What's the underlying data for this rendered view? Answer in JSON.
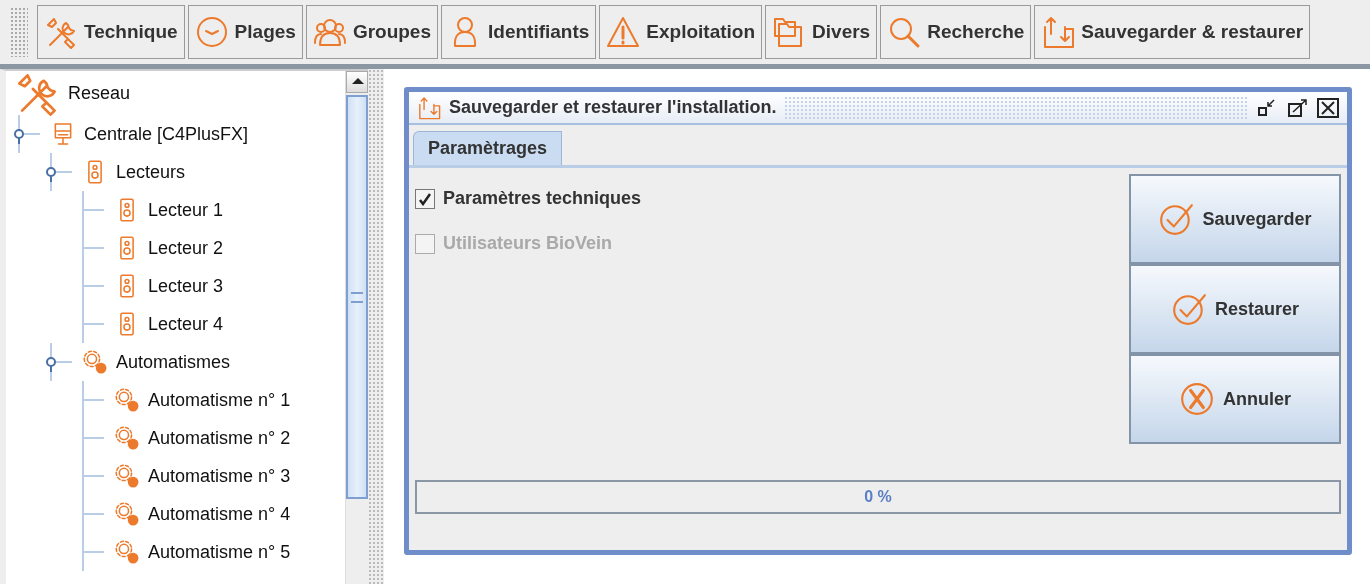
{
  "toolbar": [
    {
      "label": "Technique",
      "kind": "tools"
    },
    {
      "label": "Plages",
      "kind": "clock"
    },
    {
      "label": "Groupes",
      "kind": "group"
    },
    {
      "label": "Identifiants",
      "kind": "person"
    },
    {
      "label": "Exploitation",
      "kind": "warning"
    },
    {
      "label": "Divers",
      "kind": "folders"
    },
    {
      "label": "Recherche",
      "kind": "search"
    },
    {
      "label": "Sauvegarder & restaurer",
      "kind": "transfer"
    }
  ],
  "tree": [
    {
      "label": "Reseau",
      "kind": "tools",
      "children": [
        {
          "label": "Centrale [C4PlusFX]",
          "kind": "server",
          "expanded": true,
          "children": [
            {
              "label": "Lecteurs",
              "kind": "reader",
              "expanded": true,
              "children": [
                {
                  "label": "Lecteur 1",
                  "kind": "reader"
                },
                {
                  "label": "Lecteur 2",
                  "kind": "reader"
                },
                {
                  "label": "Lecteur 3",
                  "kind": "reader"
                },
                {
                  "label": "Lecteur 4",
                  "kind": "reader"
                }
              ]
            },
            {
              "label": "Automatismes",
              "kind": "gear",
              "expanded": true,
              "children": [
                {
                  "label": "Automatisme n° 1",
                  "kind": "gear"
                },
                {
                  "label": "Automatisme n° 2",
                  "kind": "gear"
                },
                {
                  "label": "Automatisme n° 3",
                  "kind": "gear"
                },
                {
                  "label": "Automatisme n° 4",
                  "kind": "gear"
                },
                {
                  "label": "Automatisme n° 5",
                  "kind": "gear"
                }
              ]
            }
          ]
        }
      ]
    }
  ],
  "dialog": {
    "title": "Sauvegarder et restaurer l'installation.",
    "tabs": [
      {
        "label": "Paramètrages",
        "selected": true
      }
    ],
    "options": [
      {
        "label": "Paramètres techniques",
        "checked": true,
        "disabled": false
      },
      {
        "label": "Utilisateurs BioVein",
        "checked": false,
        "disabled": true
      }
    ],
    "actions": [
      {
        "label": "Sauvegarder",
        "kind": "check"
      },
      {
        "label": "Restaurer",
        "kind": "check"
      },
      {
        "label": "Annuler",
        "kind": "cancel"
      }
    ],
    "progress": {
      "level": 0,
      "text": "0 %"
    }
  }
}
